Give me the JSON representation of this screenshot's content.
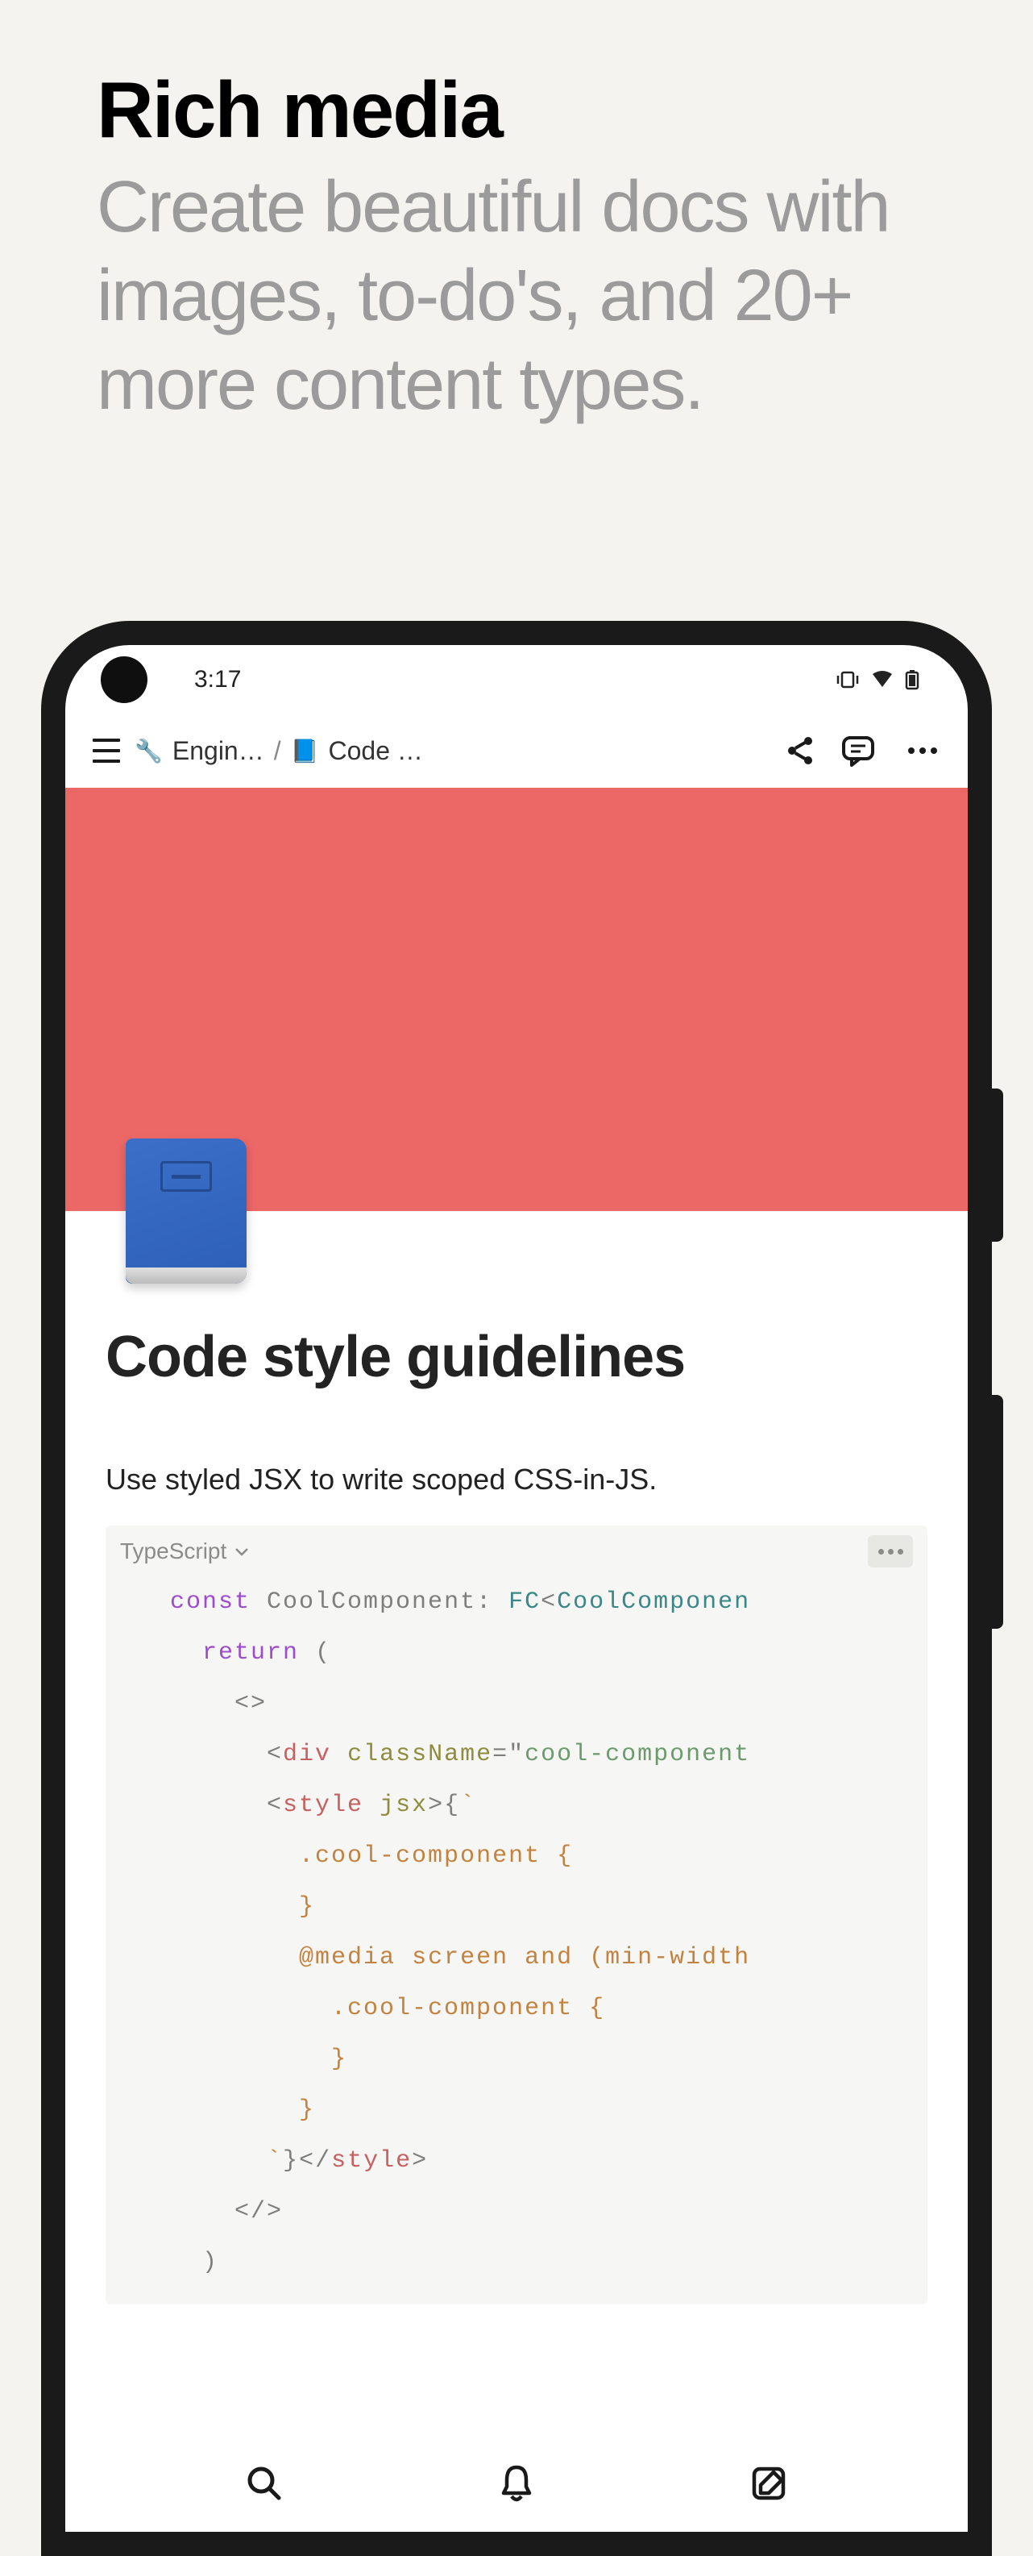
{
  "promo": {
    "title": "Rich media",
    "subtitle": "Create beautiful docs with images, to-do's, and 20+ more content types."
  },
  "statusbar": {
    "time": "3:17"
  },
  "breadcrumb": {
    "parent_icon": "🔧",
    "parent_label": "Engin…",
    "separator": "/",
    "current_icon": "📘",
    "current_label": "Code …"
  },
  "page": {
    "icon": "blue-notebook",
    "title": "Code style guidelines",
    "description": "Use styled JSX to write scoped CSS-in-JS."
  },
  "code": {
    "language": "TypeScript",
    "tokens": {
      "const": "const",
      "comp_name": "CoolComponent",
      "colon": ":",
      "fc": "FC",
      "lt": "<",
      "comp_props": "CoolComponen",
      "return": "return",
      "paren_open": "(",
      "frag_open": "<>",
      "div_open": "<",
      "div": "div",
      "class_attr": "className",
      "eq": "=",
      "quote": "\"",
      "class_val": "cool-component",
      "style": "style",
      "jsx": "jsx",
      "gt": ">",
      "brace_open": "{",
      "backtick": "`",
      "css_sel": ".cool-component",
      "css_open": "{",
      "css_close": "}",
      "media": "@media",
      "media_rule": "screen and (min-width",
      "backtick_close": "`",
      "brace_close": "}",
      "close_tag_open": "</",
      "frag_close": "</>",
      "paren_close": ")"
    }
  },
  "icons": {
    "vibrate": "vibrate-icon",
    "wifi": "wifi-icon",
    "battery": "battery-icon",
    "share": "share-icon",
    "comment": "comment-icon",
    "menu": "menu-icon",
    "search": "search-icon",
    "bell": "bell-icon",
    "compose": "compose-icon"
  }
}
